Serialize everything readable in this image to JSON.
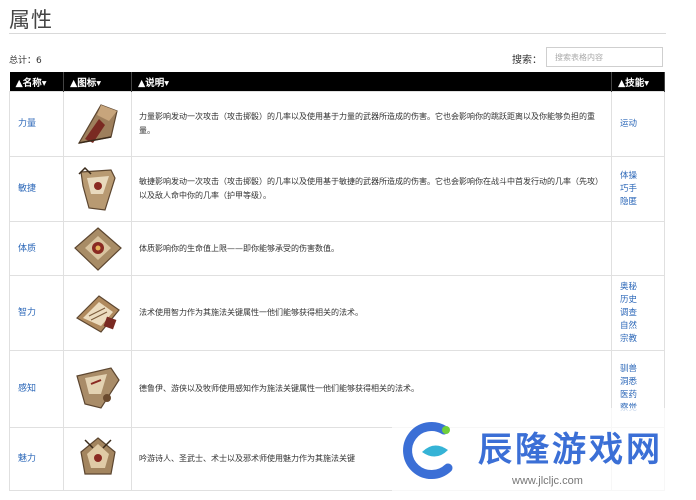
{
  "page": {
    "title": "属性"
  },
  "toolbar": {
    "total": "总计：6",
    "search_label": "搜索：",
    "search_placeholder": "搜索表格内容"
  },
  "table": {
    "headers": {
      "name": "▲名称▾",
      "icon": "▲图标▾",
      "desc": "▲说明▾",
      "skills": "▲技能▾"
    },
    "rows": [
      {
        "name": "力量",
        "icon": "strength-attribute-icon",
        "desc": "力量影响发动一次攻击（攻击掷骰）的几率以及使用基于力量的武器所造成的伤害。它也会影响你的跳跃距离以及你能够负担的重量。",
        "skills": [
          "运动"
        ]
      },
      {
        "name": "敏捷",
        "icon": "dexterity-attribute-icon",
        "desc": "敏捷影响发动一次攻击（攻击掷骰）的几率以及使用基于敏捷的武器所造成的伤害。它也会影响你在战斗中首发行动的几率（先攻）以及敌人命中你的几率（护甲等级）。",
        "skills": [
          "体操",
          "巧手",
          "隐匿"
        ]
      },
      {
        "name": "体质",
        "icon": "constitution-attribute-icon",
        "desc": "体质影响你的生命值上限——即你能够承受的伤害数值。",
        "skills": []
      },
      {
        "name": "智力",
        "icon": "intelligence-attribute-icon",
        "desc": "法术使用智力作为其施法关键属性一他们能够获得相关的法术。",
        "skills": [
          "奥秘",
          "历史",
          "调查",
          "自然",
          "宗教"
        ]
      },
      {
        "name": "感知",
        "icon": "wisdom-attribute-icon",
        "desc": "德鲁伊、游侠以及牧师使用感知作为施法关键属性一他们能够获得相关的法术。",
        "skills": [
          "驯兽",
          "洞悉",
          "医药",
          "察觉"
        ]
      },
      {
        "name": "魅力",
        "icon": "charisma-attribute-icon",
        "desc": "吟游诗人、圣武士、术士以及邪术师使用魅力作为其施法关键",
        "skills": []
      }
    ]
  },
  "watermark": {
    "name": "辰隆游戏网",
    "url": "www.jlcljc.com"
  }
}
